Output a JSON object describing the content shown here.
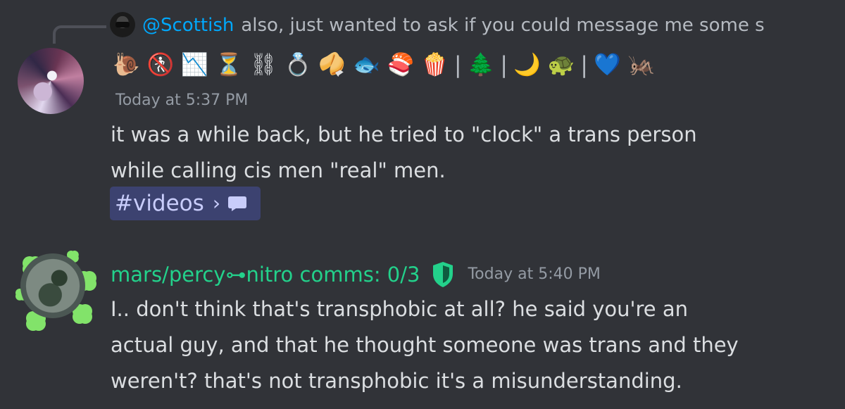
{
  "reply": {
    "username": "@Scottish",
    "text": "also, just wanted to ask if you could message me some s",
    "emoji": [
      "🐌",
      "🚷",
      "📉",
      "⏳",
      "⛓",
      "💍",
      "🥠",
      "🐟",
      "🍣",
      "🍿",
      "🌲",
      "🌙",
      "🐢",
      "💙",
      "🦗"
    ],
    "separators": [
      "|",
      "|",
      "|"
    ]
  },
  "message_1": {
    "timestamp": "Today at 5:37 PM",
    "text": "it was a while back, but he tried to \"clock\" a trans person\nwhile calling cis men \"real\" men.",
    "channel_pill": {
      "label": "#videos",
      "chevron": "›",
      "icon": "thread-icon"
    }
  },
  "message_2": {
    "author": "mars/percy⊶nitro comms: 0/3",
    "timestamp": "Today at 5:40 PM",
    "text": "I.. don't think that's transphobic at all? he said you're an\nactual guy, and that he thought someone was trans and they\nweren't? that's not transphobic it's a misunderstanding."
  },
  "colors": {
    "background": "#313338",
    "mention": "#00a8fc",
    "author_green": "#23d18b",
    "timestamp": "#949ba4",
    "pill_bg": "#3c4270",
    "pill_text": "#c9cdfb"
  }
}
